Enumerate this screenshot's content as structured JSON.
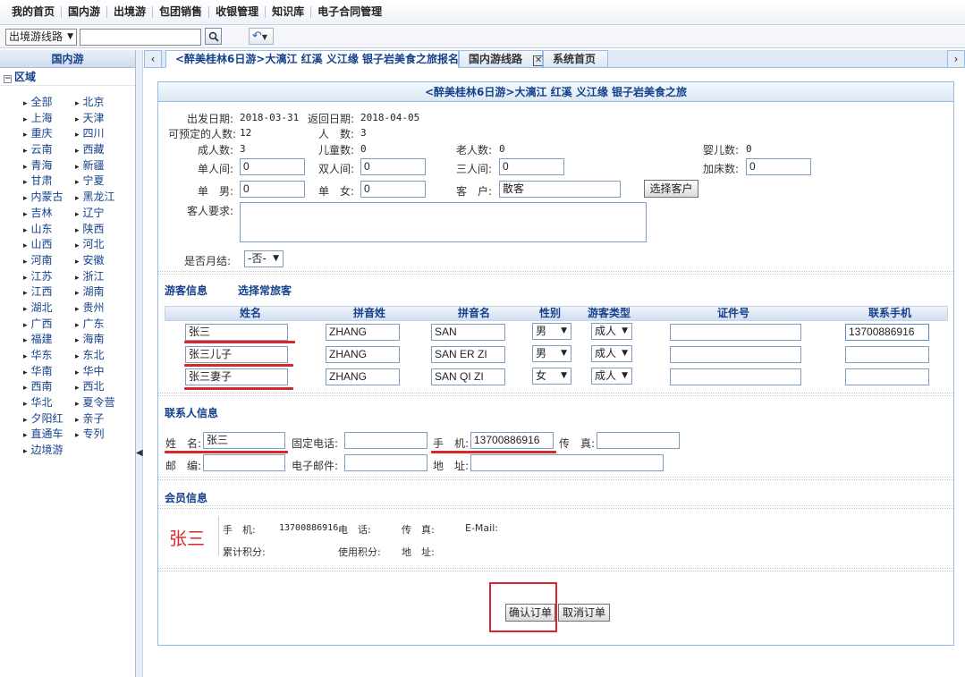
{
  "top_menu": [
    "我的首页",
    "国内游",
    "出境游",
    "包团销售",
    "收银管理",
    "知识库",
    "电子合同管理"
  ],
  "toolbar": {
    "route_select": "出境游线路",
    "search_value": "",
    "search_icon": "search-icon",
    "back_icon": "undo-icon"
  },
  "sidebar": {
    "title": "国内游",
    "region_label": "区域",
    "provinces": [
      "全部",
      "北京",
      "上海",
      "天津",
      "重庆",
      "四川",
      "云南",
      "西藏",
      "青海",
      "新疆",
      "甘肃",
      "宁夏",
      "内蒙古",
      "黑龙江",
      "吉林",
      "辽宁",
      "山东",
      "陕西",
      "山西",
      "河北",
      "河南",
      "安徽",
      "江苏",
      "浙江",
      "江西",
      "湖南",
      "湖北",
      "贵州",
      "广西",
      "广东",
      "福建",
      "海南",
      "华东",
      "东北",
      "华南",
      "华中",
      "西南",
      "西北",
      "华北",
      "夏令营",
      "夕阳红",
      "亲子",
      "直通车",
      "专列",
      "边境游"
    ]
  },
  "tabs": [
    {
      "label": "<醉美桂林6日游>大漓江 红溪 义江缘 银子岩美食之旅报名",
      "active": true
    },
    {
      "label": "国内游线路",
      "close": "✕"
    },
    {
      "label": "系统首页"
    }
  ],
  "form": {
    "title": "<醉美桂林6日游>大漓江 红溪 义江缘 银子岩美食之旅",
    "depart_label": "出发日期:",
    "depart_value": "2018-03-31",
    "return_label": "返回日期:",
    "return_value": "2018-04-05",
    "available_label": "可预定的人数:",
    "available_value": "12",
    "people_label": "人　数:",
    "people_value": "3",
    "adults_label": "成人数:",
    "adults_value": "3",
    "children_label": "儿童数:",
    "children_value": "0",
    "seniors_label": "老人数:",
    "seniors_value": "0",
    "infants_label": "婴儿数:",
    "infants_value": "0",
    "single_room_label": "单人间:",
    "single_room_value": "0",
    "double_room_label": "双人间:",
    "double_room_value": "0",
    "triple_room_label": "三人间:",
    "triple_room_value": "0",
    "extra_bed_label": "加床数:",
    "extra_bed_value": "0",
    "single_male_label": "单　男:",
    "single_male_value": "0",
    "single_female_label": "单　女:",
    "single_female_value": "0",
    "customer_label": "客　户:",
    "customer_value": "散客",
    "select_customer_button": "选择客户",
    "requirements_label": "客人要求:",
    "requirements_value": "",
    "monthly_label": "是否月结:",
    "monthly_value": "-否-"
  },
  "guests": {
    "section_title": "游客信息",
    "select_frequent": "选择常旅客",
    "columns": [
      "姓名",
      "拼音姓",
      "拼音名",
      "性别",
      "游客类型",
      "证件号",
      "联系手机"
    ],
    "rows": [
      {
        "name": "张三",
        "py_last": "ZHANG",
        "py_first": "SAN",
        "gender": "男",
        "type": "成人",
        "id_no": "",
        "phone": "13700886916"
      },
      {
        "name": "张三儿子",
        "py_last": "ZHANG",
        "py_first": "SAN ER ZI",
        "gender": "男",
        "type": "成人",
        "id_no": "",
        "phone": ""
      },
      {
        "name": "张三妻子",
        "py_last": "ZHANG",
        "py_first": "SAN QI ZI",
        "gender": "女",
        "type": "成人",
        "id_no": "",
        "phone": ""
      }
    ]
  },
  "contact": {
    "section_title": "联系人信息",
    "name_label": "姓　名:",
    "name_value": "张三",
    "landline_label": "固定电话:",
    "landline_value": "",
    "mobile_label": "手　机:",
    "mobile_value": "13700886916",
    "fax_label": "传　真:",
    "fax_value": "",
    "postcode_label": "邮　编:",
    "postcode_value": "",
    "email_label": "电子邮件:",
    "email_value": "",
    "address_label": "地　址:",
    "address_value": ""
  },
  "member": {
    "section_title": "会员信息",
    "name": "张三",
    "mobile_label": "手　机:",
    "mobile_value": "13700886916",
    "phone_label": "电　话:",
    "fax_label": "传　真:",
    "email_label": "E-Mail:",
    "points_label": "累计积分:",
    "used_points_label": "使用积分:",
    "address_label": "地　址:"
  },
  "actions": {
    "confirm": "确认订单",
    "cancel": "取消订单"
  },
  "colors": {
    "accent": "#15428b",
    "highlight_red": "#d9262a",
    "border": "#99bbe8"
  }
}
